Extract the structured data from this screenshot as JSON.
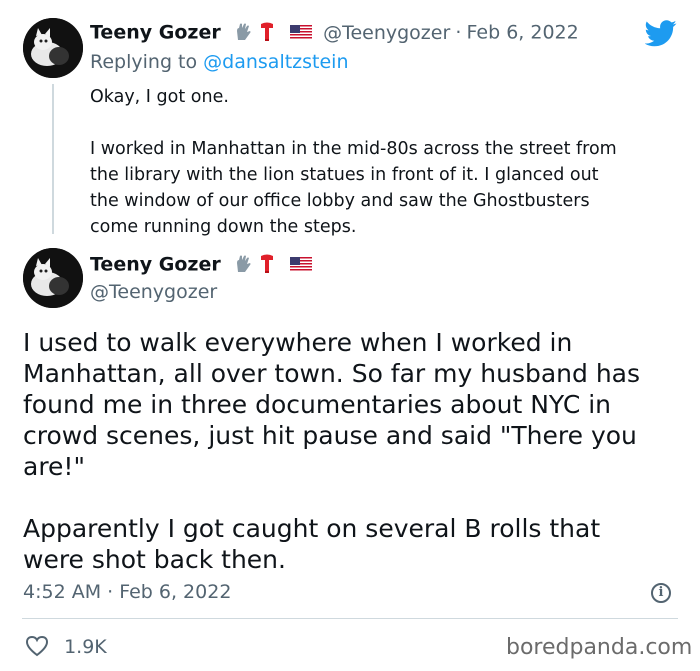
{
  "reply_tweet": {
    "author_name": "Teeny Gozer",
    "handle": "@Teenygozer",
    "separator": "·",
    "date": "Feb 6, 2022",
    "replying_prefix": "Replying to ",
    "replying_to": "@dansaltzstein",
    "text_p1": "Okay, I got one.",
    "text_p2_lines": [
      "I worked in Manhattan in the mid-80s across the street from",
      "the library with the lion statues in front of it. I glanced out",
      "the window of our office lobby and saw the Ghostbusters",
      "come running down the steps."
    ],
    "emoji_icons": [
      "glove-icon",
      "scarf-icon",
      "us-flag-icon"
    ]
  },
  "main_tweet": {
    "author_name": "Teeny Gozer",
    "handle": "@Teenygozer",
    "text_p1_lines": [
      "I used to walk everywhere when I worked in",
      "Manhattan, all over town. So far my husband has",
      "found me in three documentaries about NYC in",
      "crowd scenes, just hit pause and said \"There you",
      "are!\""
    ],
    "text_p2_lines": [
      "Apparently I got caught on several B rolls that",
      "were shot back then."
    ],
    "timestamp": "4:52 AM · Feb 6, 2022",
    "likes": "1.9K",
    "info_glyph": "i"
  },
  "brand": {
    "icon": "twitter-bird-icon",
    "color": "#1d9bf0"
  },
  "watermark": "boredpanda.com"
}
